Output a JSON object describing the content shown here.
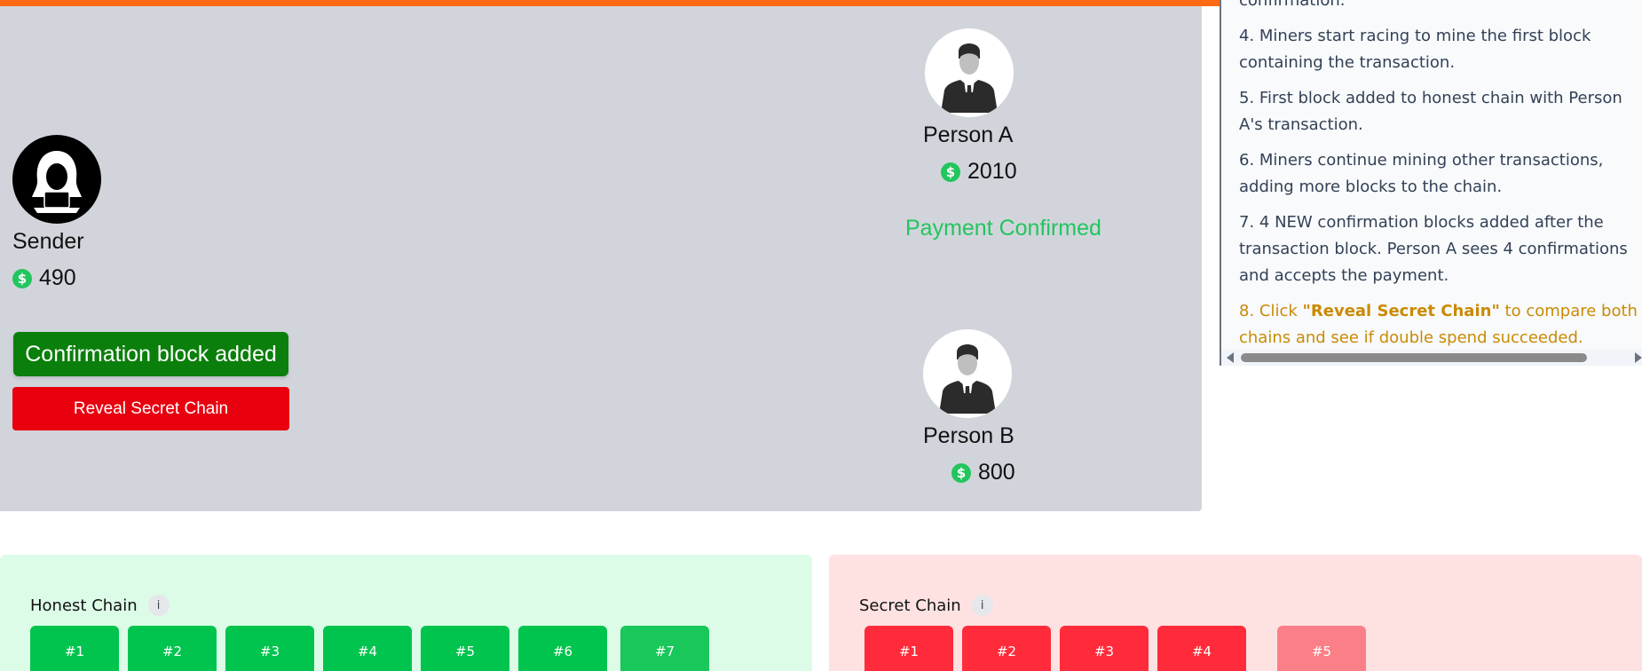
{
  "colors": {
    "accent_bar": "#ff6a13",
    "confirm_green": "#0b7f0b",
    "reveal_red": "#e8000f",
    "status_green": "#22c55e",
    "highlight_amber": "#ca8a04"
  },
  "participants": {
    "sender": {
      "name": "Sender",
      "balance": "490",
      "icon": "hacker-icon"
    },
    "person_a": {
      "name": "Person A",
      "balance": "2010",
      "icon": "businessman-icon"
    },
    "person_b": {
      "name": "Person B",
      "balance": "800",
      "icon": "businessman-icon"
    }
  },
  "currency_icon": "dollar-coin-icon",
  "status_text": "Payment Confirmed",
  "buttons": {
    "confirmation_label": "Confirmation block added",
    "reveal_label": "Reveal Secret Chain"
  },
  "instructions": {
    "partial_top": "confirmation.",
    "steps": [
      "4. Miners start racing to mine the first block containing the transaction.",
      "5. First block added to honest chain with Person A's transaction.",
      "6. Miners continue mining other transactions, adding more blocks to the chain.",
      "7. 4 NEW confirmation blocks added after the transaction block. Person A sees 4 confirmations and accepts the payment."
    ],
    "highlight": {
      "prefix": "8. Click ",
      "bold": "\"Reveal Secret Chain\"",
      "suffix": " to compare both chains and see if double spend succeeded."
    }
  },
  "honest_chain": {
    "title": "Honest Chain",
    "info_label": "i",
    "blocks": [
      "#1",
      "#2",
      "#3",
      "#4",
      "#5",
      "#6",
      "#7"
    ]
  },
  "secret_chain": {
    "title": "Secret Chain",
    "info_label": "i",
    "blocks": [
      "#1",
      "#2",
      "#3",
      "#4",
      "#5"
    ]
  }
}
